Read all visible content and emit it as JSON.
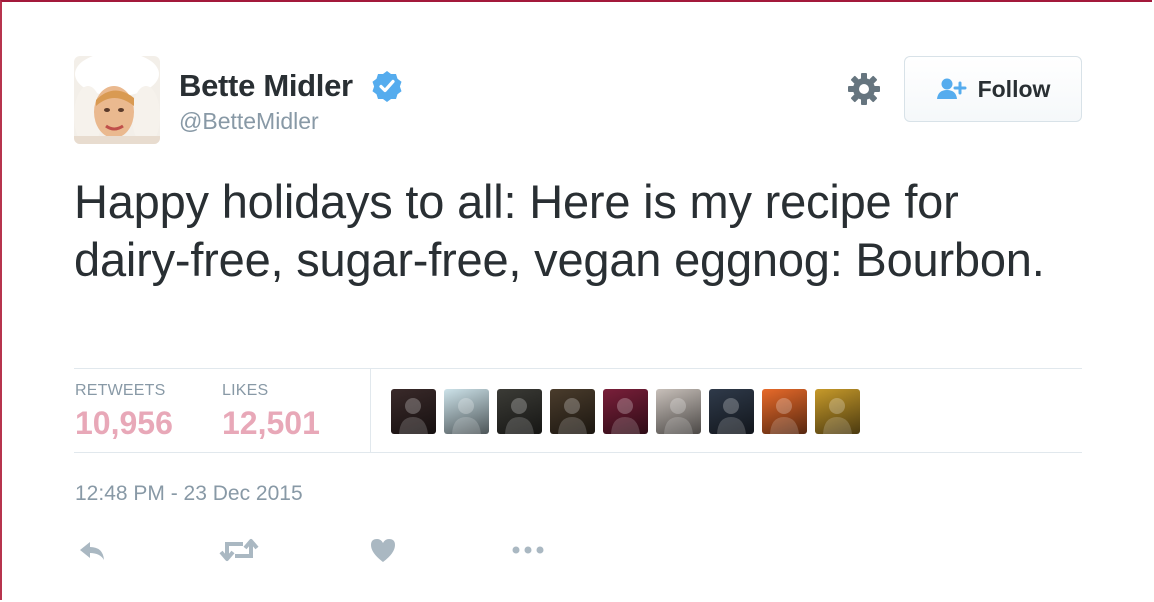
{
  "author": {
    "name": "Bette Midler",
    "handle": "@BetteMidler",
    "avatar_icon": "profile-photo"
  },
  "follow_button": {
    "label": "Follow",
    "icon": "add-user-icon"
  },
  "settings_icon": "gear-icon",
  "tweet": {
    "text": "Happy holidays to all: Here is my recipe for dairy-free, sugar-free, vegan eggnog: Bourbon."
  },
  "stats": {
    "retweets_label": "RETWEETS",
    "retweets_value": "10,956",
    "likes_label": "LIKES",
    "likes_value": "12,501"
  },
  "likers": [
    {
      "name": "liker-avatar-1",
      "color": "#3a2a2a"
    },
    {
      "name": "liker-avatar-2",
      "color": "#cde3ea"
    },
    {
      "name": "liker-avatar-3",
      "color": "#3b3b36"
    },
    {
      "name": "liker-avatar-4",
      "color": "#4a3c2c"
    },
    {
      "name": "liker-avatar-5",
      "color": "#7a1f3a"
    },
    {
      "name": "liker-avatar-6",
      "color": "#c8c0ba"
    },
    {
      "name": "liker-avatar-7",
      "color": "#2f3a4a"
    },
    {
      "name": "liker-avatar-8",
      "color": "#e86a2a"
    },
    {
      "name": "liker-avatar-9",
      "color": "#c79a2a"
    }
  ],
  "timestamp": "12:48 PM - 23 Dec 2015",
  "actions": [
    "reply-icon",
    "retweet-icon",
    "like-icon",
    "more-icon"
  ],
  "colors": {
    "text": "#292f33",
    "muted": "#8899a6",
    "stat_value": "#e8a8b8",
    "verified": "#55acee",
    "action_icon": "#aab8c2"
  }
}
